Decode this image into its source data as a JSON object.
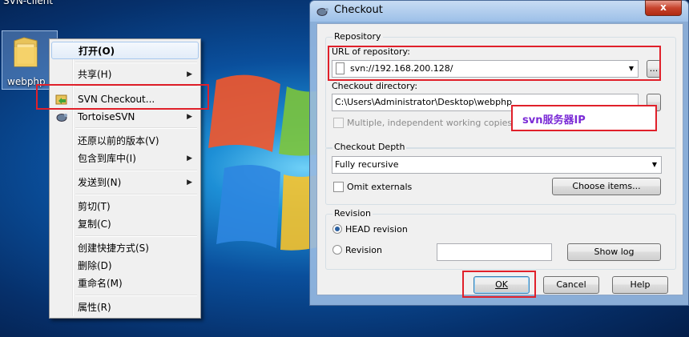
{
  "desktop": {
    "window_title": "SVN-client",
    "icon_label": "webphp"
  },
  "context_menu": {
    "items": [
      {
        "label": "打开(O)"
      },
      {
        "label": "共享(H)"
      },
      {
        "label": "SVN Checkout..."
      },
      {
        "label": "TortoiseSVN"
      },
      {
        "label": "还原以前的版本(V)"
      },
      {
        "label": "包含到库中(I)"
      },
      {
        "label": "发送到(N)"
      },
      {
        "label": "剪切(T)"
      },
      {
        "label": "复制(C)"
      },
      {
        "label": "创建快捷方式(S)"
      },
      {
        "label": "删除(D)"
      },
      {
        "label": "重命名(M)"
      },
      {
        "label": "属性(R)"
      }
    ]
  },
  "dialog": {
    "title": "Checkout",
    "close_label": "x",
    "repository_group": "Repository",
    "url_label": "URL of repository:",
    "url_value": "svn://192.168.200.128/",
    "browse_label": "...",
    "checkout_dir_label": "Checkout directory:",
    "checkout_dir_value": "C:\\Users\\Administrator\\Desktop\\webphp",
    "multiple_label": "Multiple, independent working copies",
    "depth_group": "Checkout Depth",
    "depth_value": "Fully recursive",
    "omit_label": "Omit externals",
    "choose_items_label": "Choose items...",
    "revision_group": "Revision",
    "head_revision_label": "HEAD revision",
    "revision_label": "Revision",
    "revision_value": "",
    "show_log_label": "Show log",
    "ok_label": "OK",
    "cancel_label": "Cancel",
    "help_label": "Help"
  },
  "annotation": {
    "text": "svn服务器IP"
  },
  "colors": {
    "highlight_box": "#e0202a",
    "annotation_text": "#7b2bd6"
  }
}
